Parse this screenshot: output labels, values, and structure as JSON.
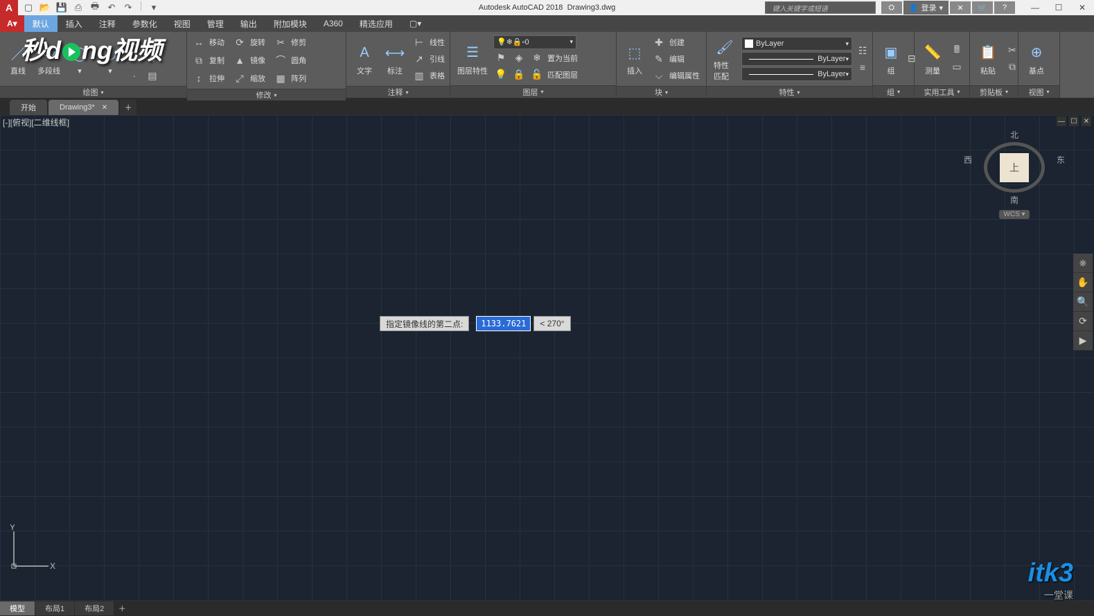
{
  "titlebar": {
    "app": "Autodesk AutoCAD 2018",
    "doc": "Drawing3.dwg",
    "search_placeholder": "键入关键字或短语",
    "login": "登录"
  },
  "menubar": {
    "tabs": [
      "默认",
      "插入",
      "注释",
      "参数化",
      "视图",
      "管理",
      "输出",
      "附加模块",
      "A360",
      "精选应用"
    ]
  },
  "ribbon": {
    "draw": {
      "label": "绘图",
      "line": "直线",
      "polyline": "多段线",
      "circle": "",
      "arc": ""
    },
    "modify": {
      "label": "修改",
      "items": [
        "移动",
        "旋转",
        "修剪"
      ],
      "items2": [
        "复制",
        "镜像",
        "圆角"
      ],
      "items3": [
        "拉伸",
        "缩放",
        "阵列"
      ]
    },
    "annotate": {
      "label": "注释",
      "text": "文字",
      "dim": "标注",
      "items": [
        "线性",
        "引线",
        "表格"
      ]
    },
    "layers": {
      "label": "图层",
      "props": "图层特性",
      "current": "0",
      "btns": [
        "置为当前",
        "匹配图层"
      ]
    },
    "block": {
      "label": "块",
      "insert": "插入",
      "items": [
        "创建",
        "编辑",
        "编辑属性"
      ]
    },
    "props": {
      "label": "特性",
      "match": "特性匹配",
      "layer": "ByLayer",
      "lt": "ByLayer",
      "lw": "ByLayer"
    },
    "group": {
      "label": "组",
      "btn": "组"
    },
    "utils": {
      "label": "实用工具",
      "m": "测量"
    },
    "clip": {
      "label": "剪贴板",
      "p": "粘贴"
    },
    "base": {
      "label": "视图",
      "b": "基点"
    }
  },
  "filetabs": {
    "start": "开始",
    "doc": "Drawing3*"
  },
  "viewport": {
    "label": "[-][俯视][二维线框]"
  },
  "dyn": {
    "prompt": "指定镜像线的第二点:",
    "value": "1133.7621",
    "angle": "< 270°"
  },
  "viewcube": {
    "n": "北",
    "s": "南",
    "e": "东",
    "w": "西",
    "top": "上",
    "wcs": "WCS"
  },
  "ucs": {
    "x": "X",
    "y": "Y"
  },
  "modeltabs": {
    "m": "模型",
    "l1": "布局1",
    "l2": "布局2"
  },
  "wm1": "秒dong视频",
  "wm2": "itk3",
  "wm2_sub": "一堂课"
}
